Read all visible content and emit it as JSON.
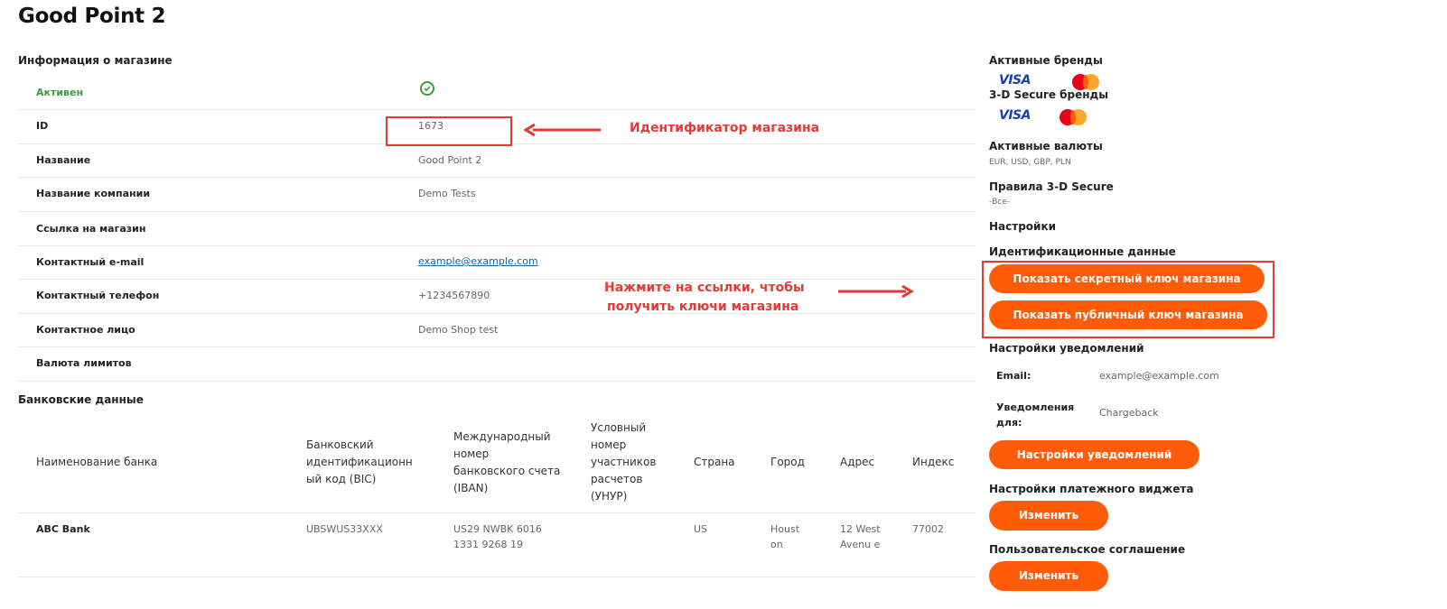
{
  "page_title": "Good Point 2",
  "store_info": {
    "heading": "Информация о магазине",
    "active_label": "Активен",
    "rows": [
      {
        "label": "ID",
        "value": "1673"
      },
      {
        "label": "Название",
        "value": "Good Point 2"
      },
      {
        "label": "Название компании",
        "value": "Demo Tests"
      },
      {
        "label": "Ссылка на магазин",
        "value": ""
      },
      {
        "label": "Контактный e-mail",
        "value": "example@example.com"
      },
      {
        "label": "Контактный телефон",
        "value": "+1234567890"
      },
      {
        "label": "Контактное лицо",
        "value": "Demo Shop test"
      },
      {
        "label": "Валюта лимитов",
        "value": ""
      }
    ]
  },
  "annotations": {
    "id_callout": "Идентификатор магазина",
    "links_callout_line1": "Нажмите на ссылки, чтобы",
    "links_callout_line2": "получить ключи магазина"
  },
  "bank": {
    "heading": "Банковские данные",
    "columns": [
      "Наименование банка",
      "Банковский идентификационн ый код (BIC)",
      "Международный номер банковского счета (IBAN)",
      "Условный номер участников расчетов (УНУР)",
      "Страна",
      "Город",
      "Адрес",
      "Индекс"
    ],
    "row": {
      "name": "ABC Bank",
      "bic": "UBSWUS33XXX",
      "iban": "US29 NWBK 6016 1331 9268 19",
      "unur": "",
      "country": "US",
      "city": "Houst on",
      "address": "12 West Avenu e",
      "index": "77002"
    }
  },
  "right_panel": {
    "active_brands_label": "Активные бренды",
    "secure_brands_label": "3-D Secure бренды",
    "visa_text": "VISA",
    "active_currencies_label": "Активные валюты",
    "currencies_value": "EUR, USD, GBP, PLN",
    "secure_rules_label": "Правила 3-D Secure",
    "secure_rules_value": "-Все-",
    "settings_label": "Настройки",
    "ident_label": "Идентификационные данные",
    "btn_secret": "Показать секретный ключ магазина",
    "btn_public": "Показать публичный ключ магазина",
    "notif_label": "Настройки уведомлений",
    "notif_email_label": "Email:",
    "notif_email_value": "example@example.com",
    "notif_for_label_1": "Уведомления",
    "notif_for_label_2": "для:",
    "notif_for_value": "Chargeback",
    "btn_notif": "Настройки уведомлений",
    "widget_label": "Настройки платежного виджета",
    "btn_change_1": "Изменить",
    "agreement_label": "Пользовательское соглашение",
    "btn_change_2": "Изменить"
  },
  "colors": {
    "accent": "#ff5c0a",
    "callout_red": "#e53935",
    "active_green": "#3d9c3d",
    "link_blue": "#1a5fa0"
  }
}
